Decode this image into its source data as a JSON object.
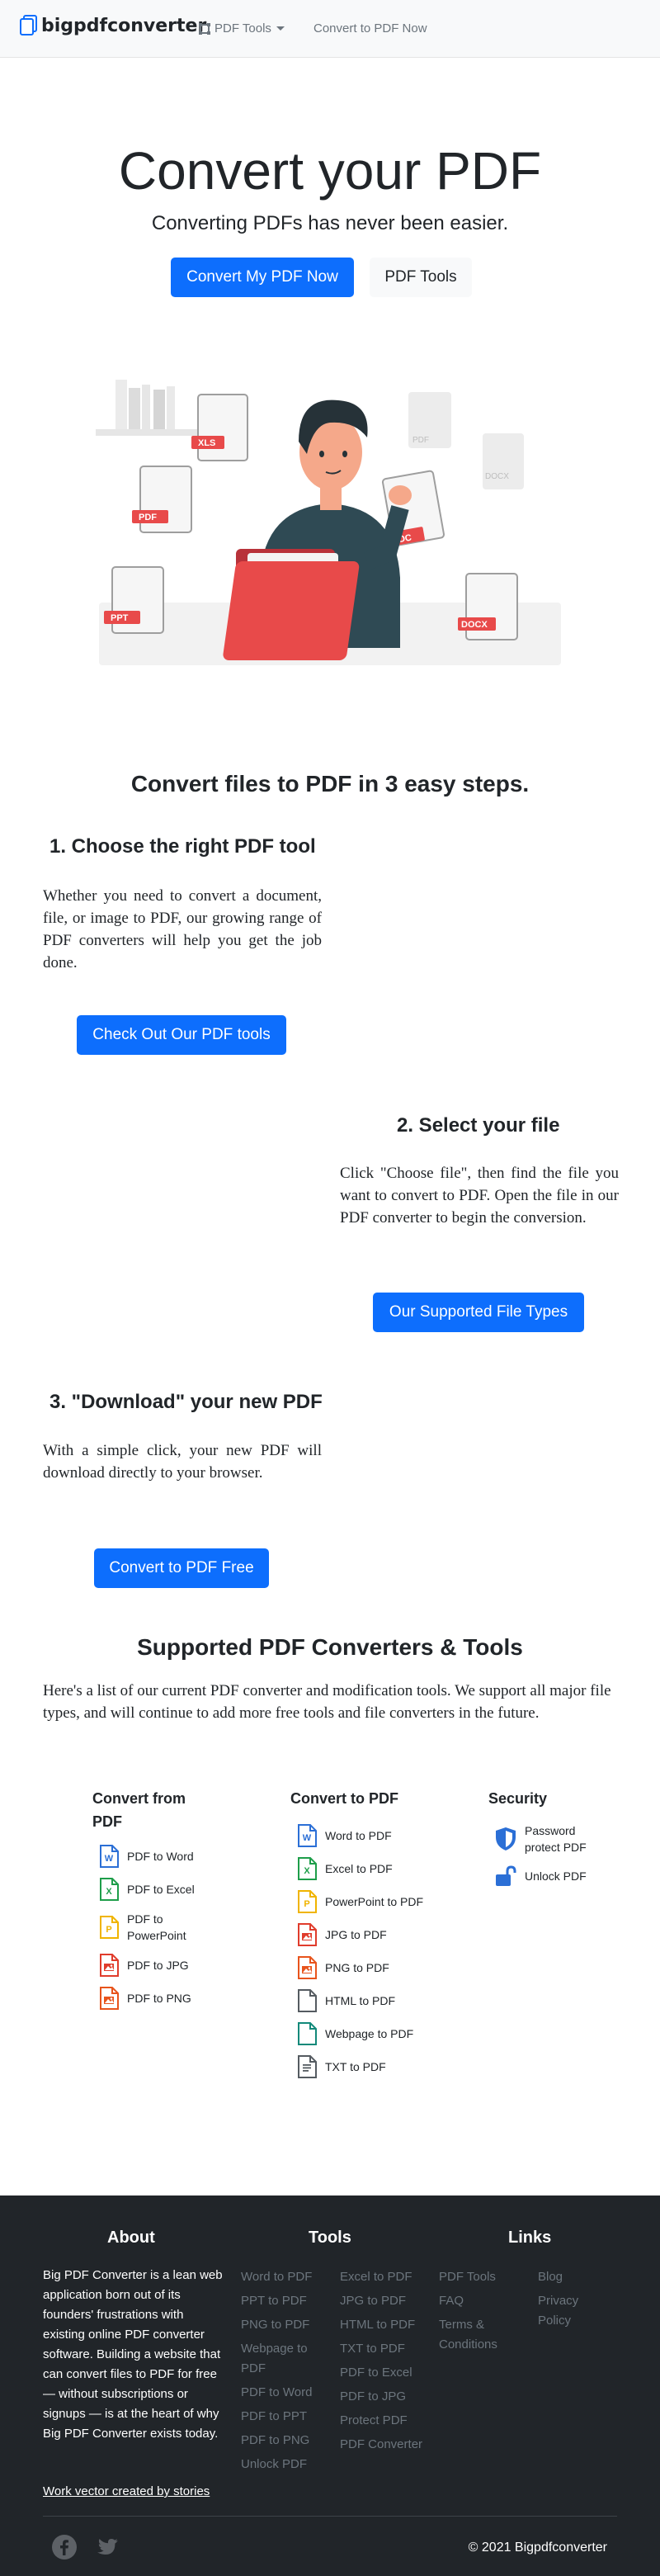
{
  "nav": {
    "brand": "bigpdfconverter",
    "tools_label": "PDF Tools",
    "convert_label": "Convert to PDF Now"
  },
  "hero": {
    "title": "Convert your PDF",
    "subtitle": "Converting PDFs has never been easier.",
    "primary_button": "Convert My PDF Now",
    "secondary_button": "PDF Tools"
  },
  "illustration": {
    "badges": [
      "XLS",
      "PDF",
      "PPT",
      "DOC",
      "DOCX",
      "PDF",
      "DOCX"
    ],
    "colors": {
      "badge": "#e84a4a",
      "shirt": "#2f4a54",
      "skin": "#f5a88a",
      "folder": "#e84a4a"
    }
  },
  "steps": {
    "title": "Convert files to PDF in 3 easy steps.",
    "items": [
      {
        "heading": "1. Choose the right PDF tool",
        "text": "Whether you need to convert a document, file, or image to PDF, our growing range of PDF converters will help you get the job done.",
        "button": "Check Out Our PDF tools"
      },
      {
        "heading": "2. Select your file",
        "text": "Click \"Choose file\", then find the file you want to convert to PDF. Open the file in our PDF converter to begin the conversion.",
        "button": "Our Supported File Types"
      },
      {
        "heading": "3. \"Download\" your new PDF",
        "text": "With a simple click, your new PDF will download directly to your browser.",
        "button": "Convert to PDF Free"
      }
    ]
  },
  "converters": {
    "title": "Supported PDF Converters & Tools",
    "intro": "Here's a list of our current PDF converter and modification tools. We support all major file types, and will continue to add more free tools and file converters in the future.",
    "columns": [
      {
        "heading": "Convert from PDF",
        "items": [
          {
            "label": "PDF to Word",
            "icon": "word-file-icon",
            "color": "#2b6fd6",
            "glyph": "W"
          },
          {
            "label": "PDF to Excel",
            "icon": "excel-file-icon",
            "color": "#1e9e4a",
            "glyph": "X"
          },
          {
            "label": "PDF to PowerPoint",
            "icon": "powerpoint-file-icon",
            "color": "#f0b400",
            "glyph": "P"
          },
          {
            "label": "PDF to JPG",
            "icon": "image-file-icon",
            "color": "#e03c2c",
            "glyph": "img"
          },
          {
            "label": "PDF to PNG",
            "icon": "image-file-icon",
            "color": "#e8541c",
            "glyph": "img"
          }
        ]
      },
      {
        "heading": "Convert to PDF",
        "items": [
          {
            "label": "Word to PDF",
            "icon": "word-file-icon",
            "color": "#2b6fd6",
            "glyph": "W"
          },
          {
            "label": "Excel to PDF",
            "icon": "excel-file-icon",
            "color": "#1e9e4a",
            "glyph": "X"
          },
          {
            "label": "PowerPoint to PDF",
            "icon": "powerpoint-file-icon",
            "color": "#f0b400",
            "glyph": "P"
          },
          {
            "label": "JPG to PDF",
            "icon": "image-file-icon",
            "color": "#e03c2c",
            "glyph": "img"
          },
          {
            "label": "PNG to PDF",
            "icon": "image-file-icon",
            "color": "#e8541c",
            "glyph": "img"
          },
          {
            "label": "HTML to PDF",
            "icon": "code-file-icon",
            "color": "#555b61",
            "glyph": "</>"
          },
          {
            "label": "Webpage to PDF",
            "icon": "code-file-icon",
            "color": "#12897a",
            "glyph": "</>"
          },
          {
            "label": "TXT to PDF",
            "icon": "text-file-icon",
            "color": "#555b61",
            "glyph": "txt"
          }
        ]
      },
      {
        "heading": "Security",
        "items": [
          {
            "label": "Password protect PDF",
            "icon": "shield-icon",
            "color": "#2b6fd6",
            "glyph": "shield"
          },
          {
            "label": "Unlock PDF",
            "icon": "unlock-icon",
            "color": "#2b6fd6",
            "glyph": "unlock"
          }
        ]
      }
    ]
  },
  "footer": {
    "about_heading": "About",
    "about_text": "Big PDF Converter is a lean web application born out of its founders' frustrations with existing online PDF converter software. Building a website that can convert files to PDF for free — without subscriptions or signups — is at the heart of why Big PDF Converter exists today.",
    "credit": "Work vector created by stories",
    "tools_heading": "Tools",
    "tools_col1": [
      "Word to PDF",
      "PPT to PDF",
      "PNG to PDF",
      "Webpage to PDF",
      "PDF to Word",
      "PDF to PPT",
      "PDF to PNG",
      "Unlock PDF"
    ],
    "tools_col2": [
      "Excel to PDF",
      "JPG to PDF",
      "HTML to PDF",
      "TXT to PDF",
      "PDF to Excel",
      "PDF to JPG",
      "Protect PDF",
      "PDF Converter"
    ],
    "tools_col3": [
      "PDF Tools",
      "FAQ",
      "Terms & Conditions"
    ],
    "links_heading": "Links",
    "links": [
      "Blog",
      "Privacy Policy"
    ],
    "copyright": "© 2021 Bigpdfconverter"
  }
}
